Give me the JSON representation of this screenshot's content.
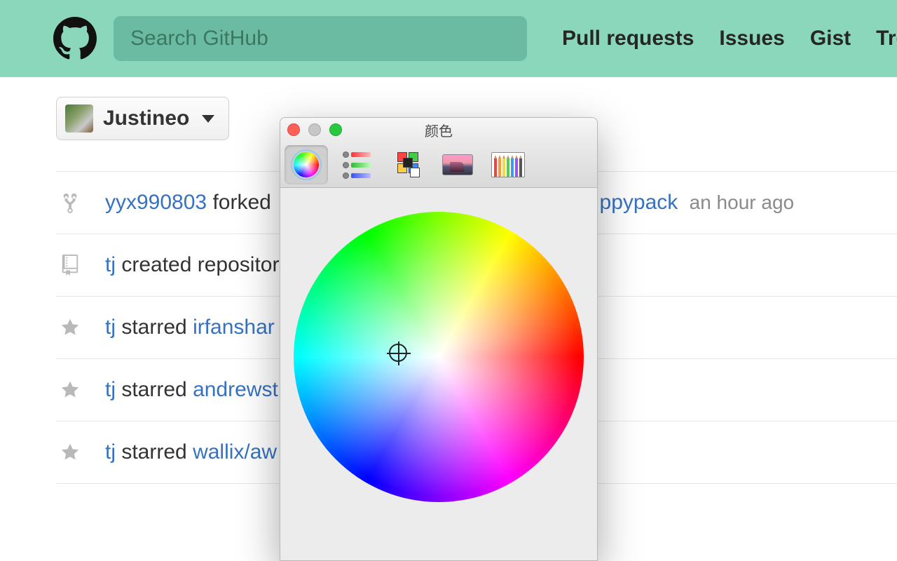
{
  "header": {
    "search_placeholder": "Search GitHub",
    "nav": [
      "Pull requests",
      "Issues",
      "Gist",
      "Trending"
    ]
  },
  "context": {
    "username": "Justineo"
  },
  "feed": [
    {
      "icon": "fork",
      "user": "yyx990803",
      "action": "forked",
      "repo_prefix": "",
      "repo_suffix": "ppypack",
      "time": "an hour ago"
    },
    {
      "icon": "repo",
      "user": "tj",
      "action": "created repository",
      "repo_prefix": "",
      "repo_suffix": "",
      "time": ""
    },
    {
      "icon": "star",
      "user": "tj",
      "action": "starred",
      "repo_prefix": "irfanshar",
      "repo_suffix": "",
      "time": ""
    },
    {
      "icon": "star",
      "user": "tj",
      "action": "starred",
      "repo_prefix": "andrewst",
      "repo_suffix": "",
      "time": ""
    },
    {
      "icon": "star",
      "user": "tj",
      "action": "starred",
      "repo_prefix": "wallix/aw",
      "repo_suffix": "",
      "time": ""
    }
  ],
  "color_panel": {
    "title": "颜色",
    "tabs": [
      "wheel",
      "sliders",
      "palette",
      "image",
      "pencils"
    ],
    "selected_tab": "wheel"
  }
}
